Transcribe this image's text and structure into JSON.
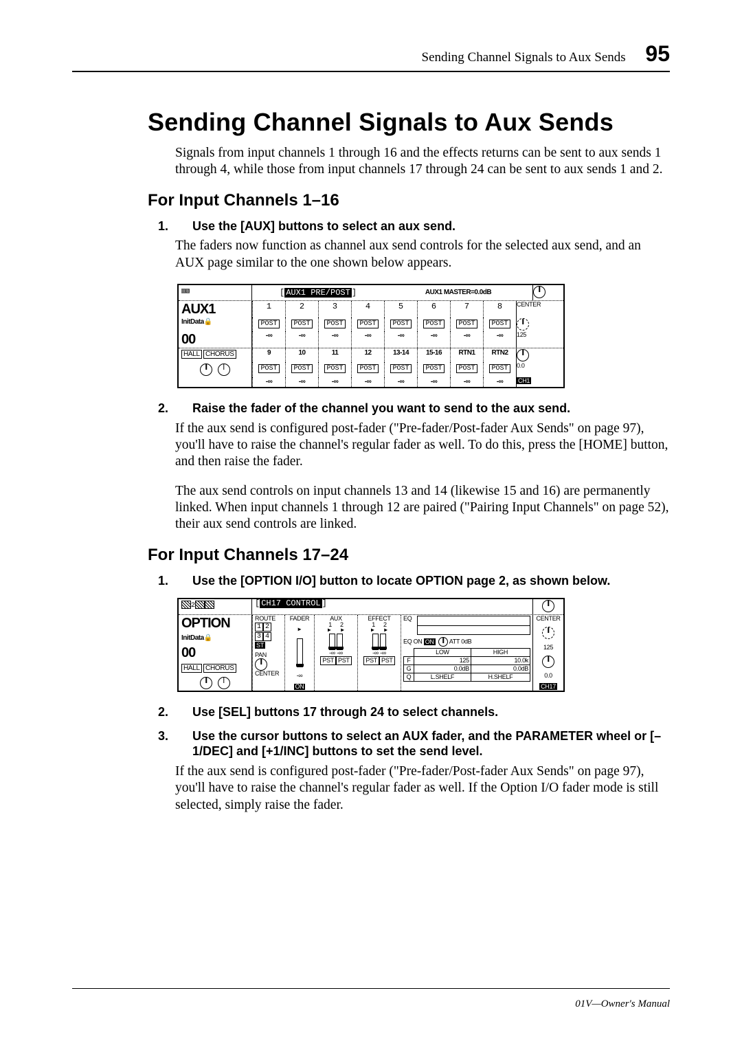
{
  "header": {
    "running_title": "Sending Channel Signals to Aux Sends",
    "page_number": "95"
  },
  "h1": "Sending Channel Signals to Aux Sends",
  "intro": "Signals from input channels 1 through 16 and the effects returns can be sent to aux sends 1 through 4, while those from input channels 17 through 24 can be sent to aux sends 1 and 2.",
  "sectionA": {
    "title": "For Input Channels 1–16",
    "step1_num": "1.",
    "step1": "Use the [AUX] buttons to select an aux send.",
    "step1_body": "The faders now function as channel aux send controls for the selected aux send, and an AUX page similar to the one shown below appears.",
    "step2_num": "2.",
    "step2": "Raise the fader of the channel you want to send to the aux send.",
    "step2_body1": "If the aux send is configured post-fader (\"Pre-fader/Post-fader Aux Sends\" on page 97), you'll have to raise the channel's regular fader as well. To do this, press the [HOME] button, and then raise the fader.",
    "step2_body2": "The aux send controls on input channels 13 and 14 (likewise 15 and 16) are permanently linked. When input channels 1 through 12 are paired (\"Pairing Input Channels\" on page 52), their aux send controls are linked."
  },
  "figure1": {
    "tab": "AUX1 PRE/POST",
    "master": "AUX1 MASTER=0.0dB",
    "side_title": "AUX1",
    "side_sub": "InitData",
    "side_counter": "00",
    "side_fx1": "HALL",
    "side_fx2": "CHORUS",
    "row1_labels": [
      "1",
      "2",
      "3",
      "4",
      "5",
      "6",
      "7",
      "8"
    ],
    "row2_labels": [
      "9",
      "10",
      "11",
      "12",
      "13-14",
      "15-16",
      "RTN1",
      "RTN2"
    ],
    "post": "POST",
    "val": "-∞",
    "r_center": "CENTER",
    "r_125": "125",
    "r_00": "0.0",
    "r_ch1": "CH1"
  },
  "sectionB": {
    "title": "For Input Channels 17–24",
    "step1_num": "1.",
    "step1": "Use the [OPTION I/O] button to locate OPTION page 2, as shown below.",
    "step2_num": "2.",
    "step2": "Use [SEL] buttons 17 through 24 to select channels.",
    "step3_num": "3.",
    "step3": "Use the cursor buttons to select an AUX fader, and the PARAMETER wheel or [–1/DEC] and [+1/INC] buttons to set the send level.",
    "step3_body": "If the aux send is configured post-fader (\"Pre-fader/Post-fader Aux Sends\" on page 97), you'll have to raise the channel's regular fader as well. If the Option I/O fader mode is still selected, simply raise the fader."
  },
  "figure2": {
    "tab": "CH17 CONTROL",
    "side_title": "OPTION",
    "side_sub": "InitData",
    "side_counter": "00",
    "side_fx1": "HALL",
    "side_fx2": "CHORUS",
    "route": "ROUTE",
    "route_opts": [
      "1",
      "2",
      "3",
      "4",
      "ST"
    ],
    "fader": "FADER",
    "pan": "PAN",
    "pan_center": "CENTER",
    "on": "ON",
    "aux": "AUX",
    "aux_cols": [
      "1",
      "2"
    ],
    "effect": "EFFECT",
    "eff_cols": [
      "1",
      "2"
    ],
    "eq": "EQ",
    "eqon": "EQ ON",
    "att": "ATT",
    "att_val": "0dB",
    "low": "LOW",
    "high": "HIGH",
    "low_freq": "125",
    "high_freq": "10.0k",
    "gain_low": "0.0dB",
    "gain_high": "0.0dB",
    "shelf_l": "L.SHELF",
    "shelf_h": "H.SHELF",
    "pst": "PST",
    "neg_inf": "-∞",
    "f": "F",
    "g": "G",
    "q": "Q",
    "r_center": "CENTER",
    "r_125": "125",
    "r_00": "0.0",
    "r_ch17": "CH17"
  },
  "footer": "01V—Owner's Manual"
}
